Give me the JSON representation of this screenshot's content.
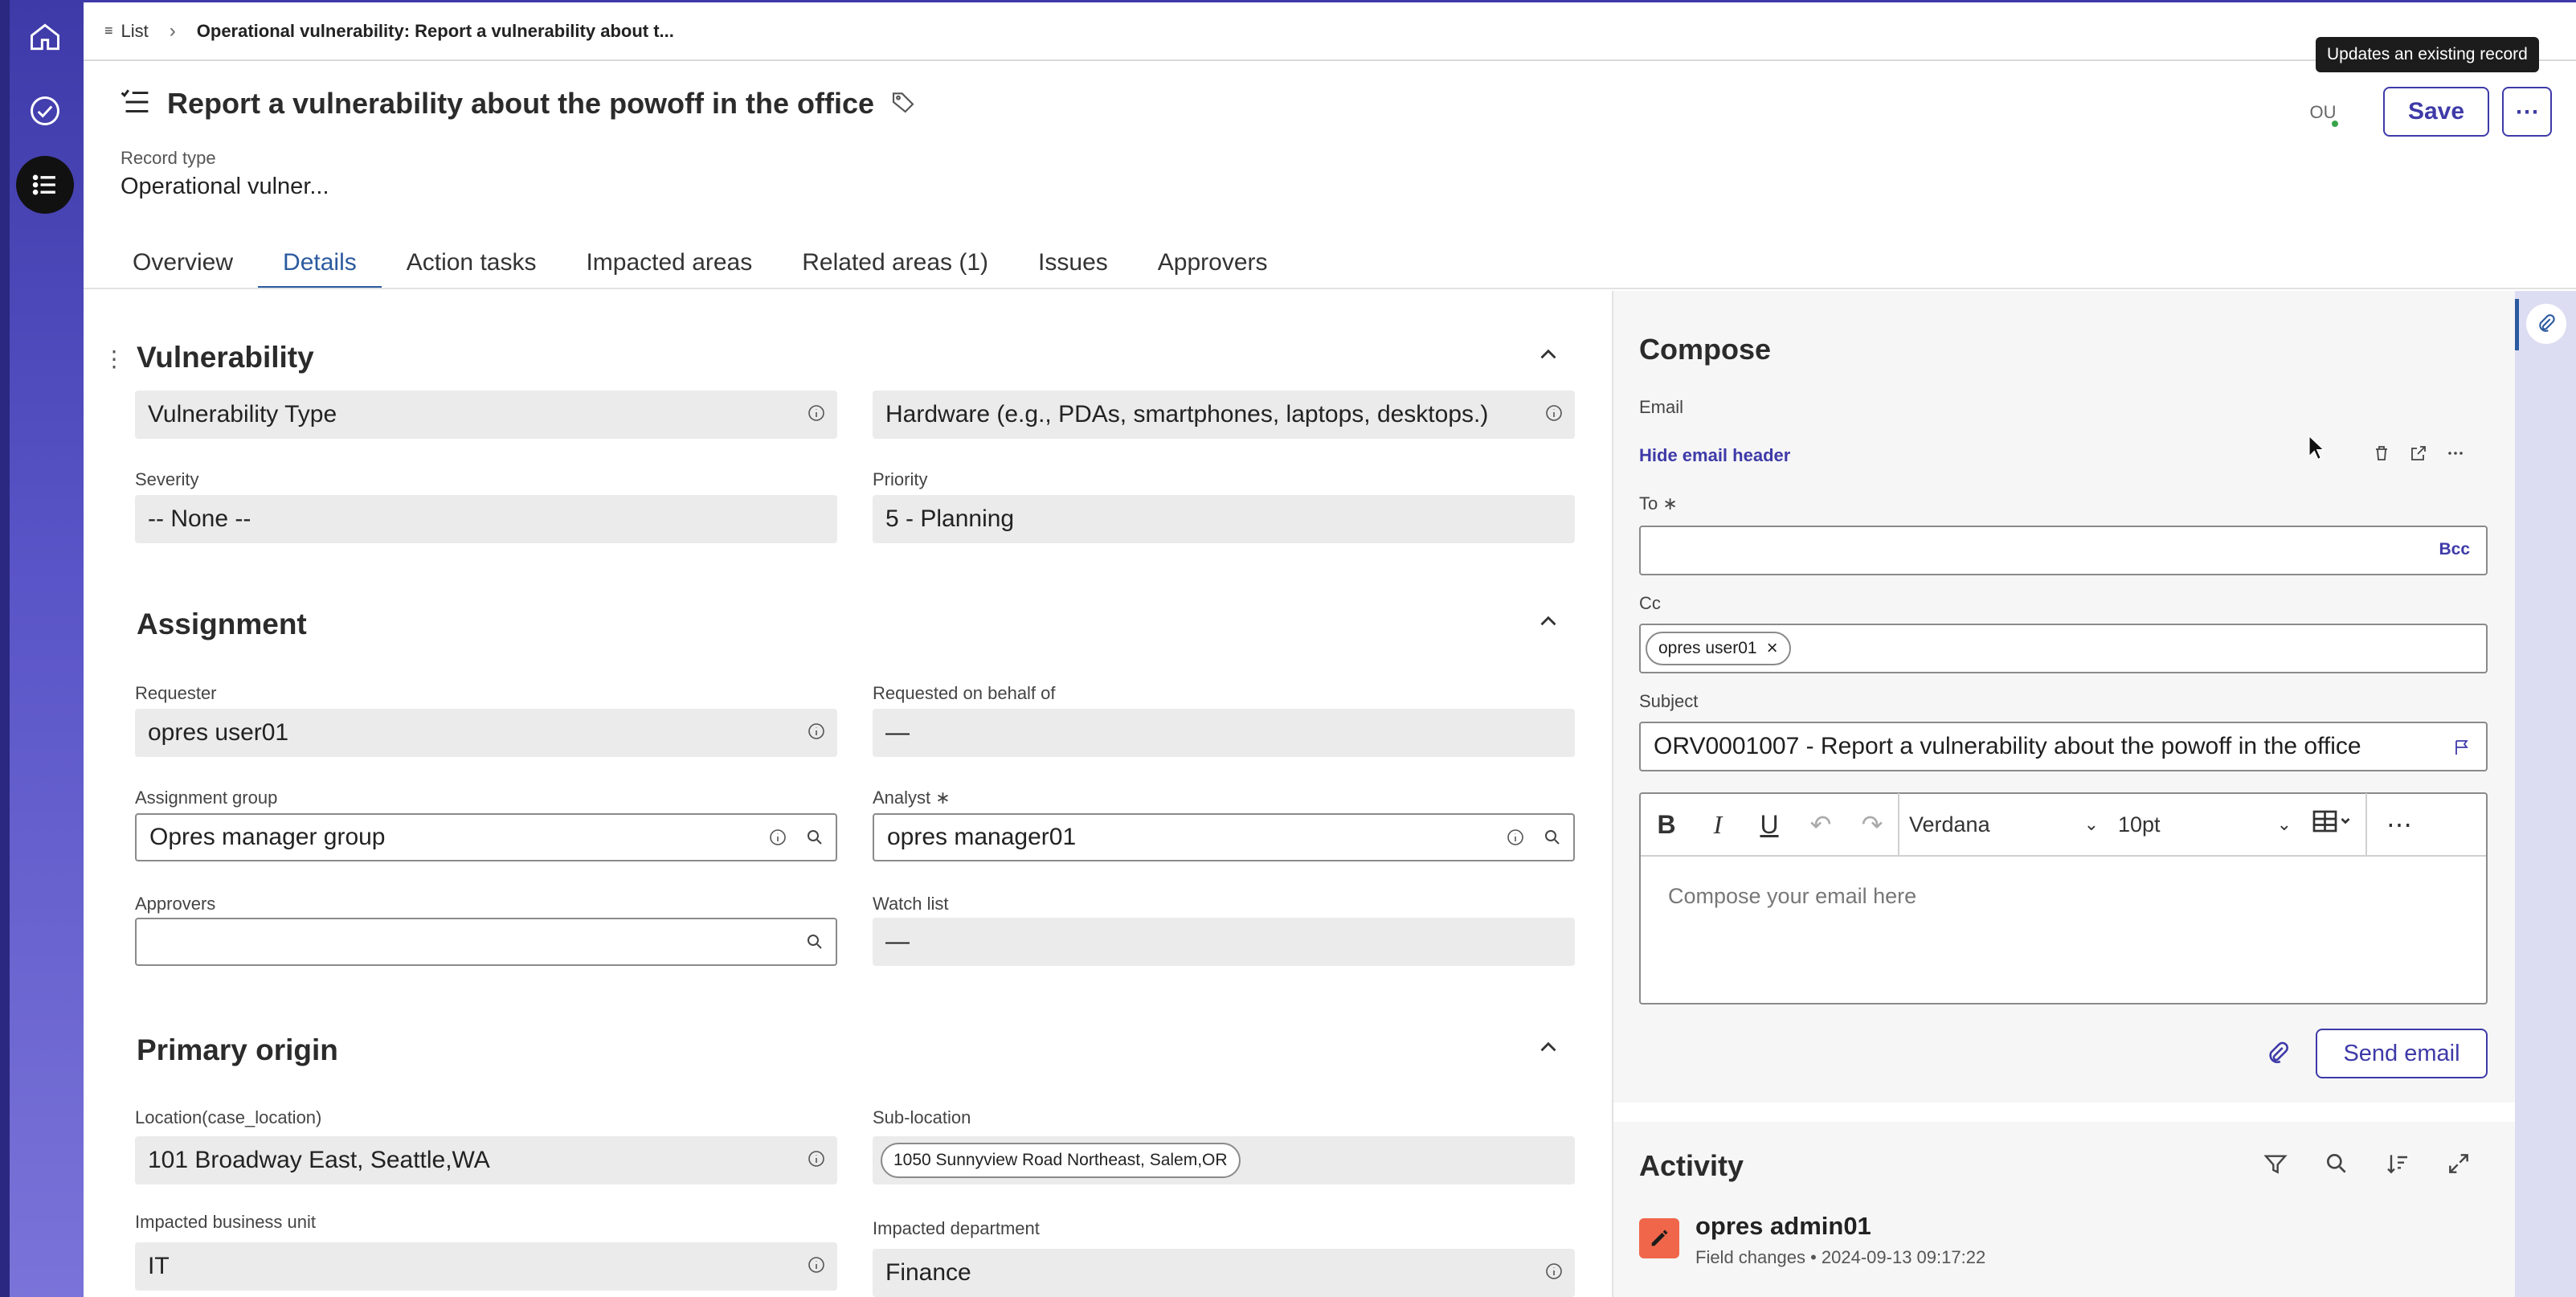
{
  "breadcrumb": {
    "list": "List",
    "current": "Operational vulnerability: Report a vulnerability about t..."
  },
  "header": {
    "title": "Report a vulnerability about the powoff in the office",
    "record_type_label": "Record type",
    "record_type_value": "Operational vulner...",
    "tooltip": "Updates an existing record",
    "avatar": "OU",
    "save": "Save",
    "more": "⋯"
  },
  "tabs": [
    "Overview",
    "Details",
    "Action tasks",
    "Impacted areas",
    "Related areas (1)",
    "Issues",
    "Approvers"
  ],
  "active_tab": "Details",
  "form": {
    "vulnerability": {
      "heading": "Vulnerability",
      "type_label_value": "Vulnerability Type",
      "type_value": "Hardware (e.g., PDAs, smartphones, laptops, desktops.)",
      "severity_label": "Severity",
      "severity_value": "-- None --",
      "priority_label": "Priority",
      "priority_value": "5 - Planning"
    },
    "assignment": {
      "heading": "Assignment",
      "requester_label": "Requester",
      "requester_value": "opres user01",
      "behalf_label": "Requested on behalf of",
      "behalf_value": "—",
      "group_label": "Assignment group",
      "group_value": "Opres manager group",
      "analyst_label": "Analyst",
      "analyst_value": "opres manager01",
      "approvers_label": "Approvers",
      "approvers_value": "",
      "watch_label": "Watch list",
      "watch_value": "—"
    },
    "origin": {
      "heading": "Primary origin",
      "location_label": "Location(case_location)",
      "location_value": "101 Broadway East, Seattle,WA",
      "sublocation_label": "Sub-location",
      "sublocation_value": "1050 Sunnyview Road Northeast, Salem,OR",
      "unit_label": "Impacted business unit",
      "unit_value": "IT",
      "dept_label": "Impacted department",
      "dept_value": "Finance"
    }
  },
  "compose": {
    "title": "Compose",
    "email_label": "Email",
    "hide_header": "Hide email header",
    "to_label": "To",
    "bcc": "Bcc",
    "cc_label": "Cc",
    "cc_chip": "opres user01",
    "subject_label": "Subject",
    "subject_value": "ORV0001007 - Report a vulnerability about the powoff in the office",
    "font": "Verdana",
    "size": "10pt",
    "placeholder": "Compose your email here",
    "send": "Send email"
  },
  "activity": {
    "title": "Activity",
    "user": "opres admin01",
    "meta": "Field changes • 2024-09-13 09:17:22"
  },
  "colors": {
    "brand": "#3e3aa8",
    "tab_active": "#2b5a9e",
    "field_bg": "#ebebeb",
    "activity_icon": "#f0664a"
  }
}
